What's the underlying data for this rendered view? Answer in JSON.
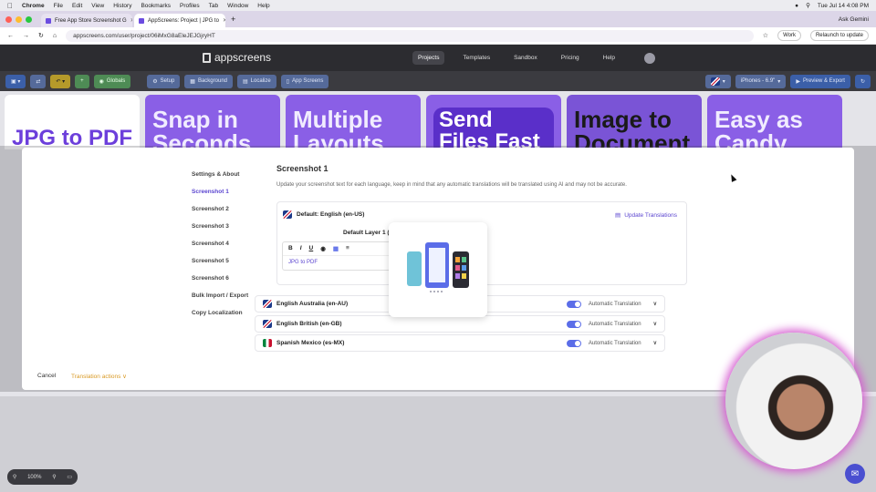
{
  "menubar": {
    "app": "Chrome",
    "items": [
      "File",
      "Edit",
      "View",
      "History",
      "Bookmarks",
      "Profiles",
      "Tab",
      "Window",
      "Help"
    ],
    "clock": "Tue Jul 14  4:08 PM"
  },
  "tabs": [
    {
      "title": "Free App Store Screenshot G"
    },
    {
      "title": "AppScreens: Project | JPG to"
    }
  ],
  "browser": {
    "ask_gemini": "Ask Gemini",
    "url": "appscreens.com/user/project/06iMxG8aEleJEJGjryHT",
    "profile": "Work",
    "relaunch": "Relaunch to update"
  },
  "appnav": {
    "logo": "appscreens",
    "links": [
      "Projects",
      "Templates",
      "Sandbox",
      "Pricing",
      "Help"
    ]
  },
  "toolbar": {
    "globals": "Globals",
    "setup": "Setup",
    "background": "Background",
    "localize": "Localize",
    "app_screens": "App Screens",
    "device": "iPhones - 6.9\"",
    "preview": "Preview & Export"
  },
  "cards": [
    {
      "text": "JPG to PDF"
    },
    {
      "text": "Snap in Seconds"
    },
    {
      "text": "Multiple Layouts"
    },
    {
      "text": "Send Files Fast"
    },
    {
      "text": "Image to Document"
    },
    {
      "text": "Easy as Candy"
    }
  ],
  "modal": {
    "sidebar": [
      "Settings & About",
      "Screenshot 1",
      "Screenshot 2",
      "Screenshot 3",
      "Screenshot 4",
      "Screenshot 5",
      "Screenshot 6",
      "Bulk Import / Export",
      "Copy Localization"
    ],
    "active": "Screenshot 1",
    "title": "Screenshot 1",
    "description": "Update your screenshot text for each language, keep in mind that any automatic translations will be translated using AI and may not be accurate.",
    "default_lang": "Default: English (en-US)",
    "update_translations": "Update Translations",
    "layer_title": "Default Layer 1 (b",
    "editor_text": "JPG to PDF",
    "languages": [
      {
        "name": "English Australia (en-AU)",
        "auto": "Automatic Translation"
      },
      {
        "name": "English British (en-GB)",
        "auto": "Automatic Translation"
      },
      {
        "name": "Spanish Mexico (es-MX)",
        "auto": "Automatic Translation"
      }
    ],
    "cancel": "Cancel",
    "translation_actions": "Translation actions"
  },
  "zoom": {
    "level": "100%"
  }
}
